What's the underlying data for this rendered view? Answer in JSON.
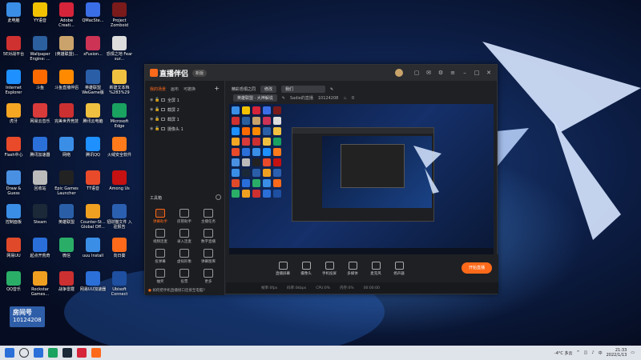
{
  "desktop": {
    "icons": [
      {
        "label": "此电脑",
        "color": "#3a8ee6"
      },
      {
        "label": "YY语音",
        "color": "#f2c200"
      },
      {
        "label": "Adobe Creati...",
        "color": "#d6243a"
      },
      {
        "label": "QMacSte...",
        "color": "#3a6ee6"
      },
      {
        "label": "Project Zomboid",
        "color": "#7a1a1a"
      },
      {
        "label": "5E对战平台",
        "color": "#cf3030"
      },
      {
        "label": "Wallpaper Engine: ...",
        "color": "#2b5f9e"
      },
      {
        "label": "(英雄联盟)...",
        "color": "#c9a36b"
      },
      {
        "label": "xFusion...",
        "color": "#cc3355"
      },
      {
        "label": "恐惧之地 Fear sur...",
        "color": "#ddd"
      },
      {
        "label": "Internet Explorer",
        "color": "#1e90ff"
      },
      {
        "label": "斗鱼",
        "color": "#ff6a00"
      },
      {
        "label": "斗鱼直播伴侣",
        "color": "#ff8a00"
      },
      {
        "label": "英雄联盟 WeGame版",
        "color": "#2a5fa8"
      },
      {
        "label": "新建文本档 %283%29",
        "color": "#f0c040"
      },
      {
        "label": "虎牙",
        "color": "#f5a623"
      },
      {
        "label": "网易云音乐",
        "color": "#d93a3a"
      },
      {
        "label": "完美世界竞技",
        "color": "#cc3030"
      },
      {
        "label": "腾讯云电脑",
        "color": "#f0c040"
      },
      {
        "label": "Microsoft Edge",
        "color": "#1aa260"
      },
      {
        "label": "Flash中心",
        "color": "#e84a2a"
      },
      {
        "label": "腾讯加速器",
        "color": "#2b6fd9"
      },
      {
        "label": "网络",
        "color": "#3a8ee6"
      },
      {
        "label": "腾讯QQ",
        "color": "#1e90ff"
      },
      {
        "label": "火绒安全软件",
        "color": "#ff7a1a"
      },
      {
        "label": "Draw & Guess",
        "color": "#4a90e2"
      },
      {
        "label": "回收站",
        "color": "#bbbbbb"
      },
      {
        "label": "Epic Games Launcher",
        "color": "#222222"
      },
      {
        "label": "TT语音",
        "color": "#e84a2a"
      },
      {
        "label": "Among Us",
        "color": "#c51111"
      },
      {
        "label": "控制面板",
        "color": "#3a8ee6"
      },
      {
        "label": "Steam",
        "color": "#1b2838"
      },
      {
        "label": "英雄联盟",
        "color": "#2a5fa8"
      },
      {
        "label": "Counter-St... Global Off...",
        "color": "#f0a020"
      },
      {
        "label": "招财猫文件 入驻报告",
        "color": "#2b5fb0"
      },
      {
        "label": "网易UU",
        "color": "#e04a2a"
      },
      {
        "label": "起点开荒奇",
        "color": "#2a6fd9"
      },
      {
        "label": "微信",
        "color": "#2aae67"
      },
      {
        "label": "uuu Install",
        "color": "#3a8ee6"
      },
      {
        "label": "向日葵",
        "color": "#ff6a1a"
      },
      {
        "label": "QQ音乐",
        "color": "#2aae67"
      },
      {
        "label": "Rockstar Games...",
        "color": "#f0a020"
      },
      {
        "label": "战争雷霆",
        "color": "#cc3030"
      },
      {
        "label": "网易UU加速器",
        "color": "#2b6fd9"
      },
      {
        "label": "Ubisoft Connect",
        "color": "#1e4fa0"
      }
    ],
    "streamer_tag": {
      "name": "房间号",
      "room": "10124208"
    }
  },
  "app": {
    "logo": "直播伴侣",
    "version": "新版",
    "tabs": [
      "我的场景",
      "画布",
      "可撤换"
    ],
    "scenes": [
      "全屏 1",
      "截屏 2",
      "截屏 1",
      "摄像头 1"
    ],
    "tools_title": "工具箱",
    "tools": [
      "弹幕助手",
      "房管助手",
      "主播任务",
      "视频连麦",
      "录入连麦",
      "数字直播",
      "投弹幕",
      "虚拟形象",
      "弹幕图库",
      "抽奖",
      "投票",
      "更多"
    ],
    "hint": "如何把手机直播接口连接至电脑?",
    "room_title": "精彩恐惧之同",
    "room_tag1": "修改",
    "room_tag2": "我们",
    "room_game": "英雄联盟 · 大神解说",
    "room_meta": "Sadie的直播",
    "room_id": "10124208",
    "room_count": "0",
    "bottom_tools": [
      "直播屏幕",
      "摄像头",
      "手机投屏",
      "多媒体",
      "麦克风",
      "扬声器"
    ],
    "start_label": "开始直播",
    "status": [
      "帧率:0fps",
      "码率:0kbps",
      "CPU:0%",
      "内存:0%",
      "00:00:00"
    ]
  },
  "taskbar": {
    "weather": "-4°C 多云",
    "lang": "中",
    "time": "21:33",
    "date": "2022/1/13"
  },
  "colors": {
    "accent": "#ff6a1a"
  }
}
